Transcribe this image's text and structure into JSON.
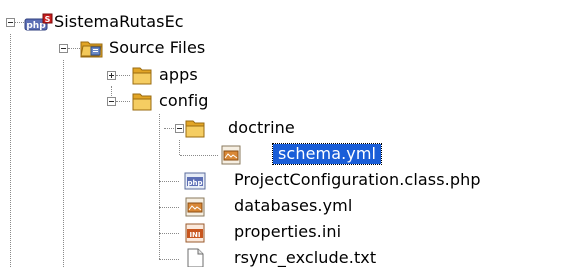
{
  "tree": {
    "project": {
      "label": "SistemaRutasEc",
      "icon": "php-project-icon"
    },
    "source_files": {
      "label": "Source Files",
      "icon": "source-folder-icon"
    },
    "apps": {
      "label": "apps",
      "icon": "folder-icon"
    },
    "config": {
      "label": "config",
      "icon": "folder-icon"
    },
    "doctrine": {
      "label": "doctrine",
      "icon": "folder-icon"
    },
    "schema": {
      "label": "schema.yml",
      "icon": "yml-file-icon",
      "selected": true
    },
    "project_configuration": {
      "label": "ProjectConfiguration.class.php",
      "icon": "php-file-icon"
    },
    "databases": {
      "label": "databases.yml",
      "icon": "yml-file-icon"
    },
    "properties": {
      "label": "properties.ini",
      "icon": "ini-file-icon"
    },
    "rsync_exclude": {
      "label": "rsync_exclude.txt",
      "icon": "text-file-icon"
    },
    "php_badge": "php",
    "ini_badge": "INI"
  },
  "colors": {
    "selection": "#1a5ed8",
    "folder": "#e9b73a",
    "tree_lines": "#8a8a8a"
  }
}
